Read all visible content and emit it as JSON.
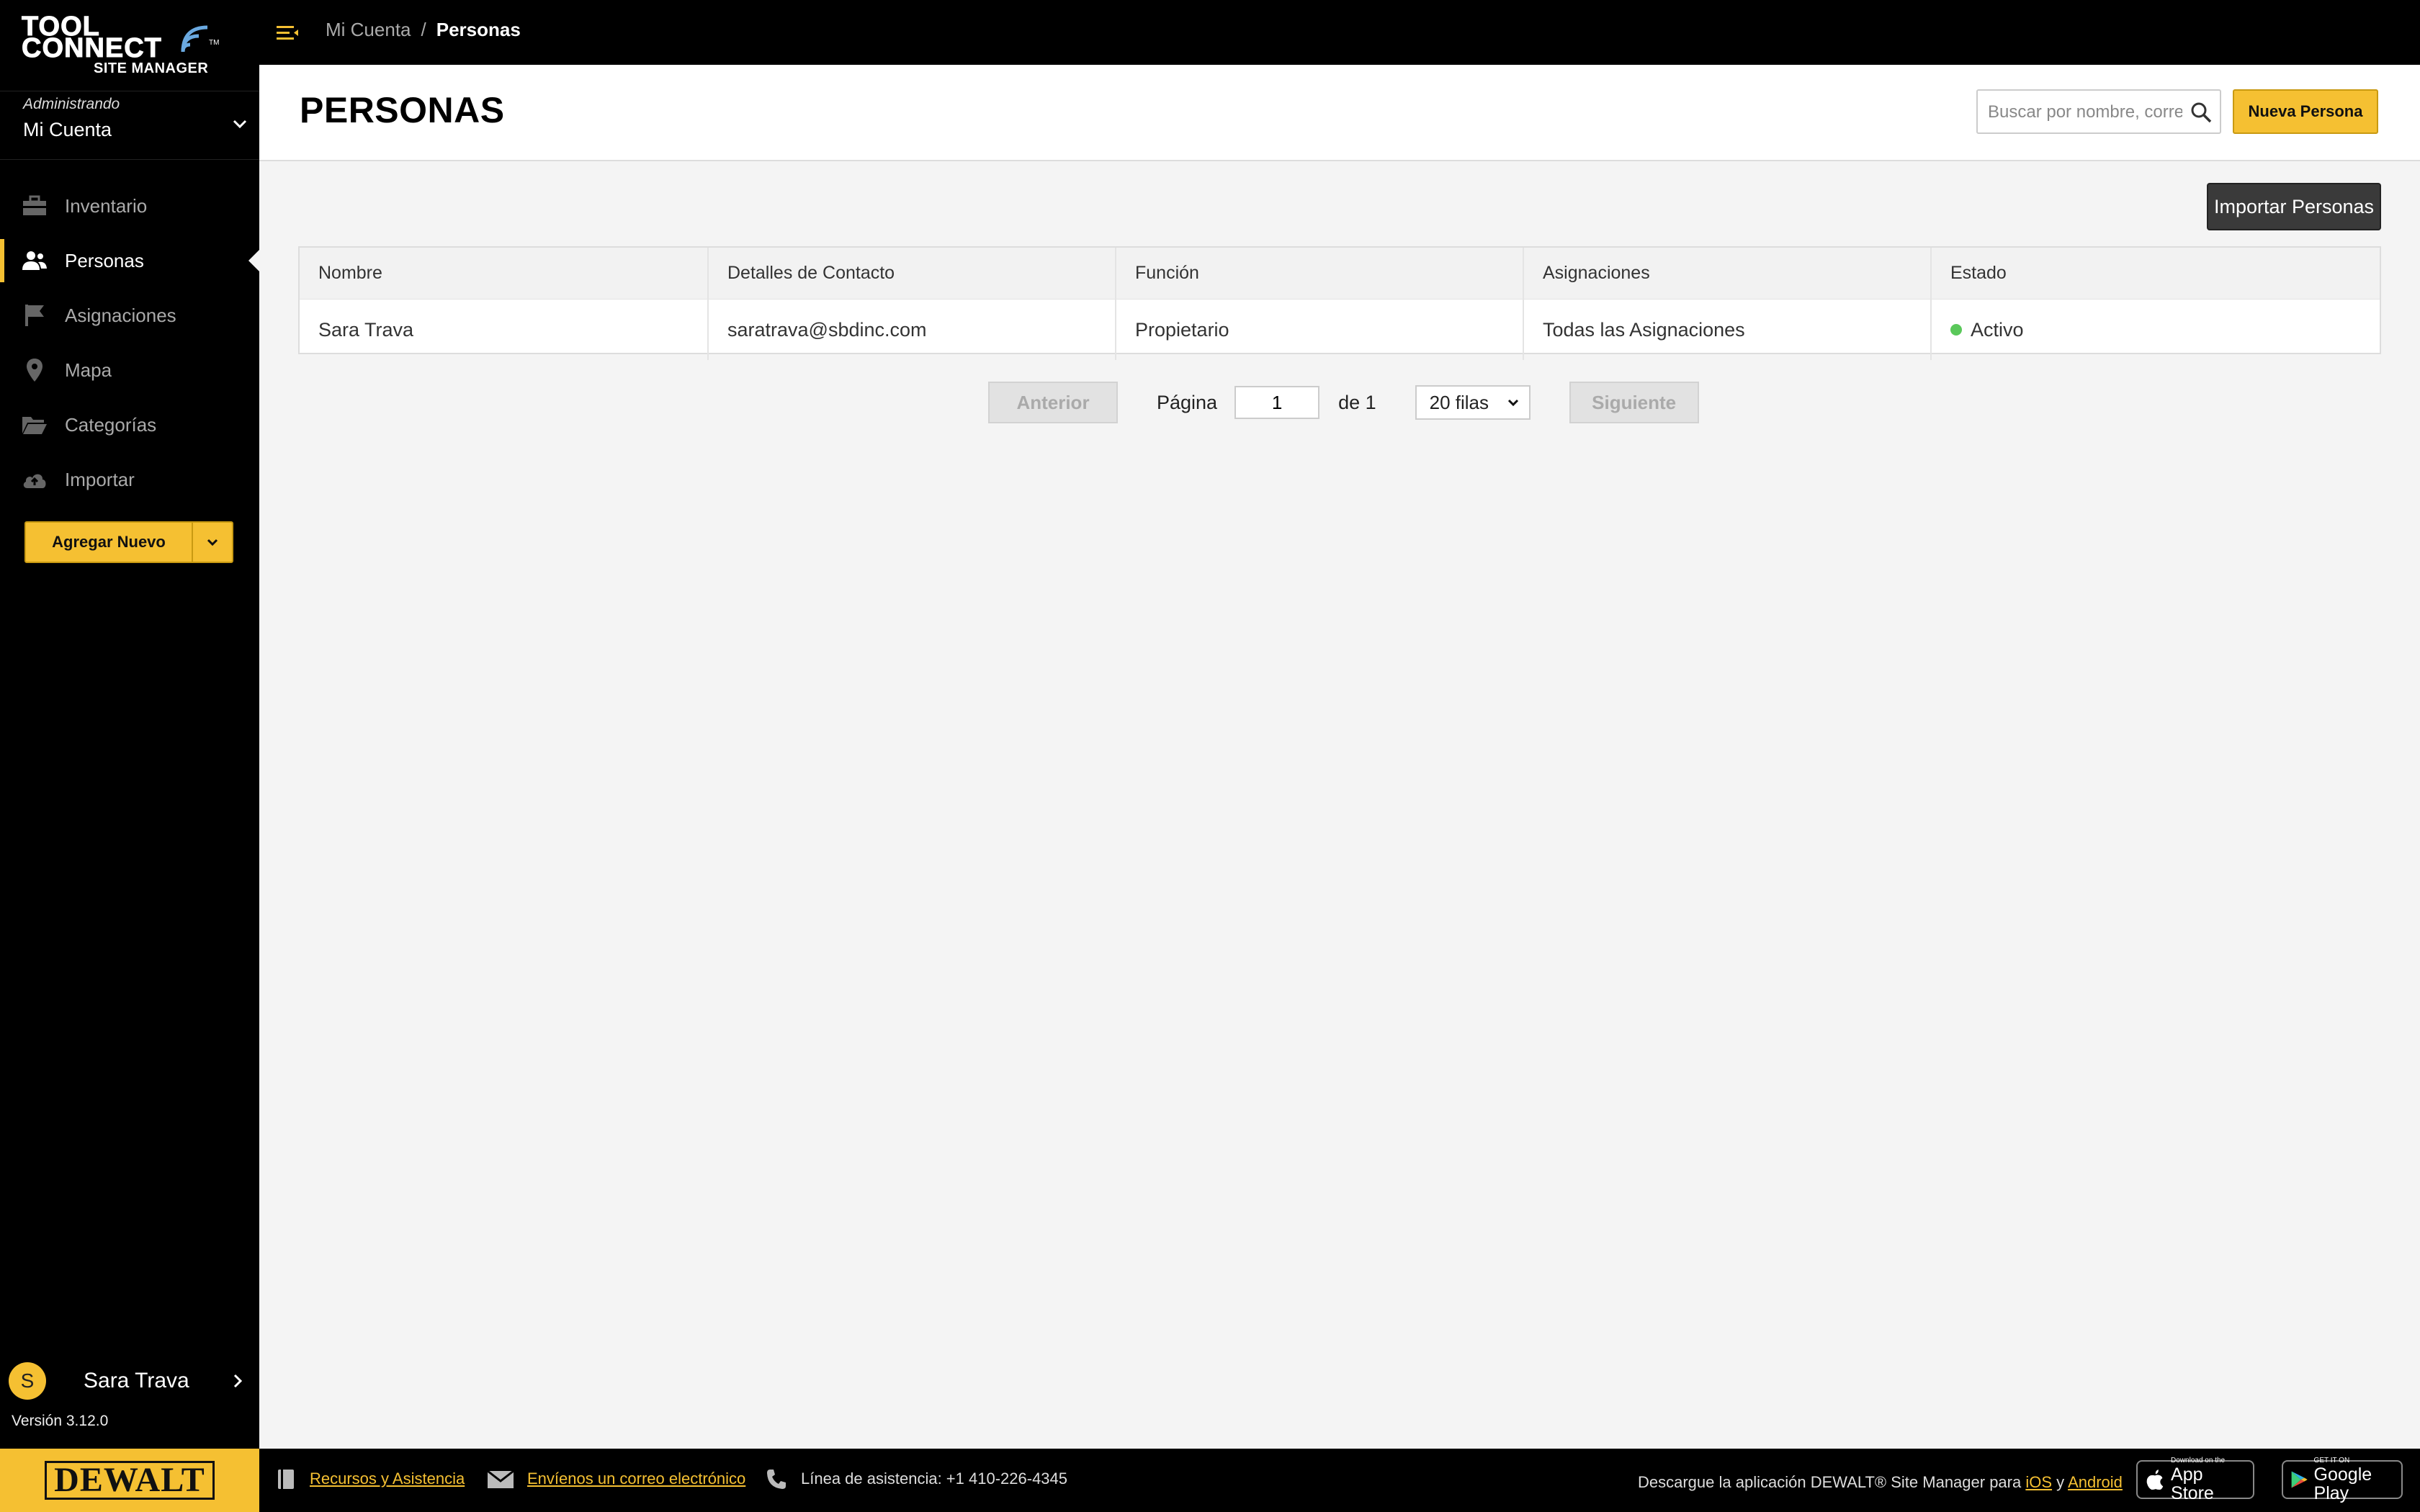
{
  "brand": {
    "logo_line1": "TOOL",
    "logo_line2": "CONNECT",
    "logo_line3": "SITE MANAGER",
    "trademark": "TM",
    "footer_brand": "DEWALT",
    "accent_color": "#f5c032"
  },
  "account": {
    "administering_label": "Administrando",
    "name": "Mi Cuenta"
  },
  "nav": {
    "items": [
      {
        "label": "Inventario",
        "icon": "toolbox-icon"
      },
      {
        "label": "Personas",
        "icon": "people-icon"
      },
      {
        "label": "Asignaciones",
        "icon": "flag-icon"
      },
      {
        "label": "Mapa",
        "icon": "map-pin-icon"
      },
      {
        "label": "Categorías",
        "icon": "folder-icon"
      },
      {
        "label": "Importar",
        "icon": "cloud-upload-icon"
      }
    ],
    "active": "Personas",
    "add_new_label": "Agregar Nuevo"
  },
  "user": {
    "initial": "S",
    "name": "Sara Trava",
    "version": "Versión 3.12.0"
  },
  "breadcrumb": {
    "parent": "Mi Cuenta",
    "separator": "/",
    "current": "Personas"
  },
  "page": {
    "title": "PERSONAS",
    "search_placeholder": "Buscar por nombre, correo electrónico",
    "new_person_label": "Nueva Persona",
    "import_label": "Importar Personas"
  },
  "table": {
    "columns": [
      "Nombre",
      "Detalles de Contacto",
      "Función",
      "Asignaciones",
      "Estado"
    ],
    "rows": [
      {
        "name": "Sara Trava",
        "contact": "saratrava@sbdinc.com",
        "role": "Propietario",
        "assignments": "Todas las Asignaciones",
        "status": "Activo",
        "status_color": "#5ac85a"
      }
    ]
  },
  "pagination": {
    "prev_label": "Anterior",
    "page_label": "Página",
    "current_page": "1",
    "of_label": "de 1",
    "rows_select": "20 filas",
    "next_label": "Siguiente"
  },
  "footer": {
    "resources_link": "Recursos y Asistencia",
    "email_link": "Envíenos un correo electrónico",
    "helpline": "Línea de asistencia: +1 410-226-4345",
    "download_text": "Descargue la aplicación DEWALT® Site Manager para",
    "ios_link": "iOS",
    "and_text": "y",
    "android_link": "Android",
    "appstore_small": "Download on the",
    "appstore_big": "App Store",
    "googleplay_small": "GET IT ON",
    "googleplay_big": "Google Play"
  }
}
